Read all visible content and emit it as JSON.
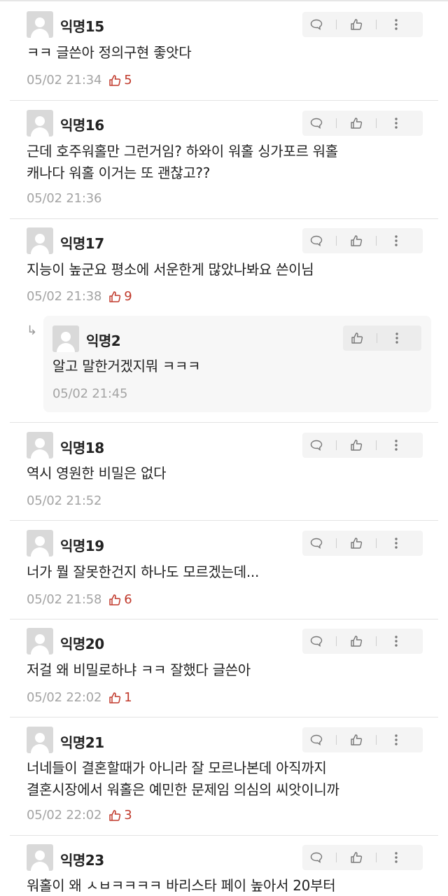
{
  "comments": [
    {
      "name": "익명15",
      "lines": [
        "ㅋㅋ 글쓴아 정의구현 좋앗다"
      ],
      "time": "05/02 21:34",
      "likes": "5"
    },
    {
      "name": "익명16",
      "lines": [
        "근데 호주워홀만 그런거임? 하와이 워홀 싱가포르 워홀",
        "캐나다 워홀 이거는 또 괜찮고??"
      ],
      "time": "05/02 21:36",
      "likes": ""
    },
    {
      "name": "익명17",
      "lines": [
        "지능이 높군요 평소에 서운한게 많았나봐요 쓴이님"
      ],
      "time": "05/02 21:38",
      "likes": "9"
    },
    {
      "name": "익명18",
      "lines": [
        "역시 영원한 비밀은 없다"
      ],
      "time": "05/02 21:52",
      "likes": ""
    },
    {
      "name": "익명19",
      "lines": [
        "너가 뭘 잘못한건지 하나도 모르겠는데..."
      ],
      "time": "05/02 21:58",
      "likes": "6"
    },
    {
      "name": "익명20",
      "lines": [
        "저걸 왜 비밀로하냐 ㅋㅋ 잘했다 글쓴아"
      ],
      "time": "05/02 22:02",
      "likes": "1"
    },
    {
      "name": "익명21",
      "lines": [
        "너네들이 결혼할때가 아니라 잘 모르나본데 아직까지",
        "결혼시장에서 워홀은 예민한 문제임 의심의 씨앗이니까"
      ],
      "time": "05/02 22:02",
      "likes": "3"
    },
    {
      "name": "익명23",
      "lines": [
        "워홀이 왜 ㅅㅂㅋㅋㅋㅋ 바리스타 페이 높아서 20부터"
      ],
      "time": "",
      "likes": ""
    }
  ],
  "reply": {
    "name": "익명2",
    "lines": [
      "알고 말한거겠지뭐 ㅋㅋㅋ"
    ],
    "time": "05/02 21:45",
    "arrow": "↳"
  },
  "colors": {
    "like_accent": "#c0392b",
    "meta_gray": "#a4a4a4",
    "avatar_bg": "#d9d9d9"
  },
  "icons": {
    "comment": "comment-icon",
    "like": "thumbs-up-icon",
    "more": "more-vertical-icon",
    "reply": "reply-arrow-icon"
  }
}
